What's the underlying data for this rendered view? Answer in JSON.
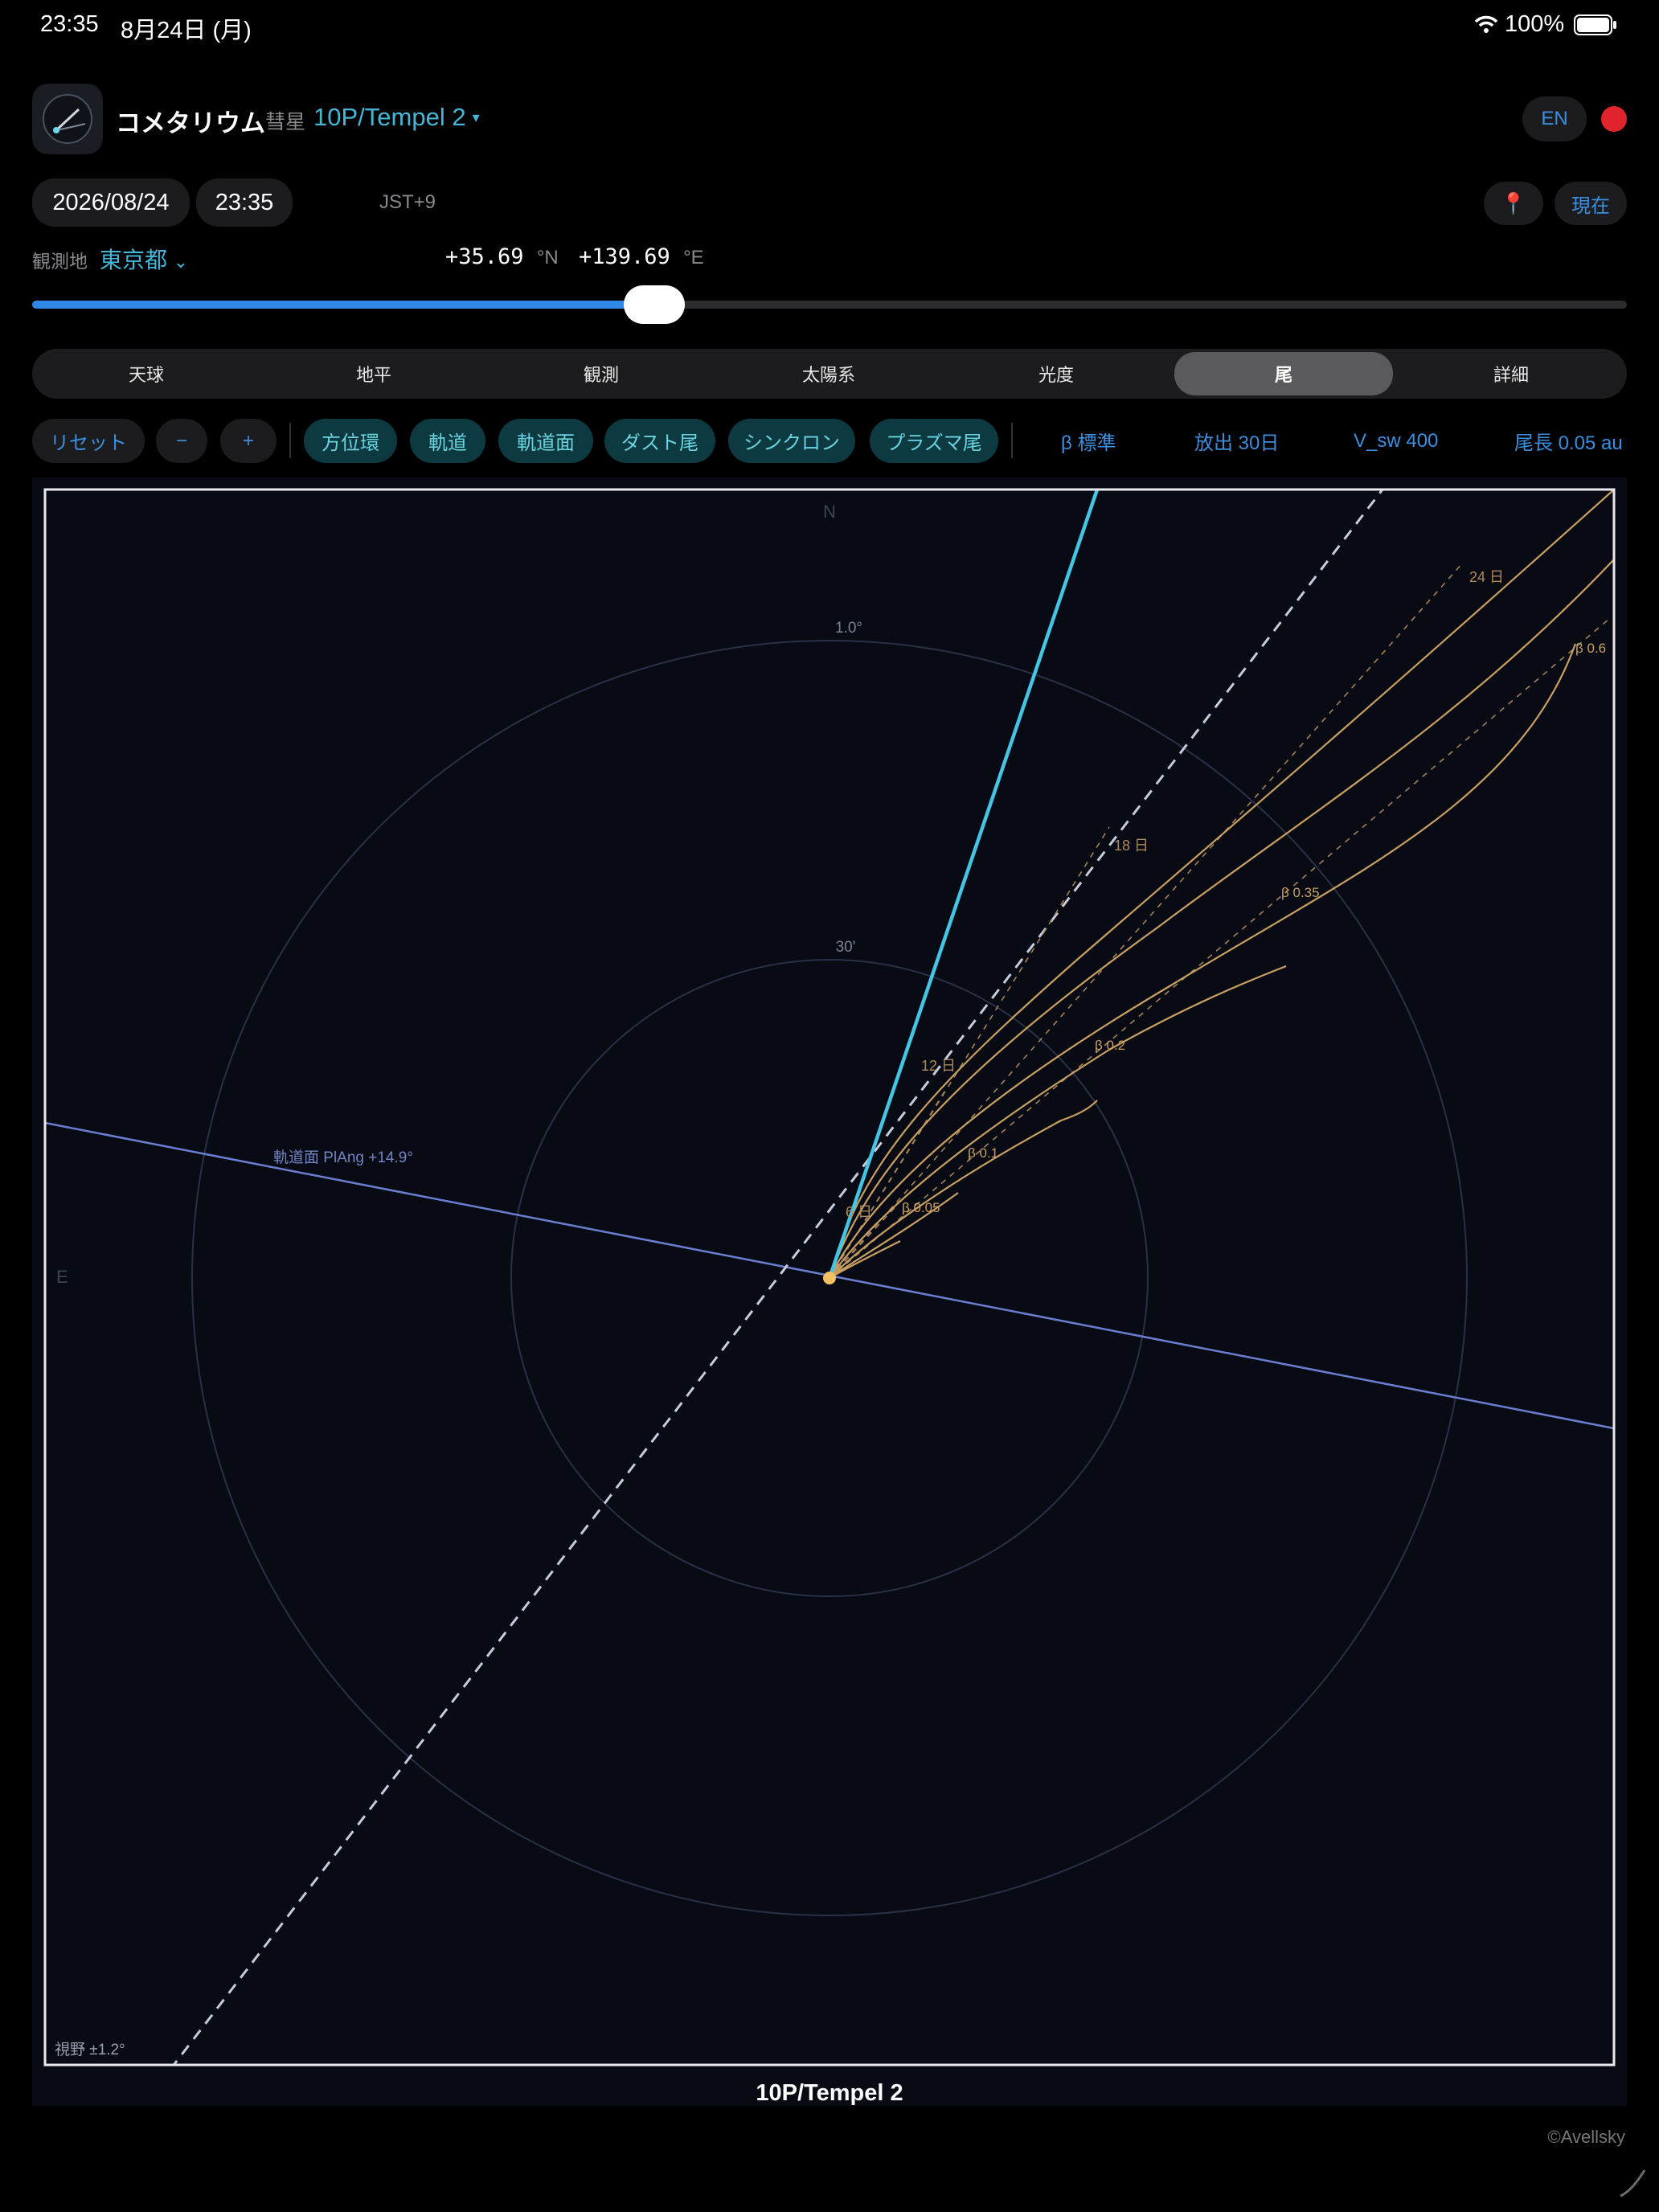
{
  "status_bar": {
    "time": "23:35",
    "date": "8月24日 (月)",
    "battery": "100%"
  },
  "header": {
    "app_name": "コメタリウム",
    "subtitle": "彗星",
    "comet_name": "10P/Tempel 2",
    "caret": "▾",
    "lang_button": "EN"
  },
  "datetime": {
    "date": "2026/08/24",
    "time": "23:35",
    "timezone": "JST+9",
    "pin_icon": "📍",
    "now_button": "現在"
  },
  "location": {
    "label": "観測地",
    "value": "東京都",
    "chevron": "⌄",
    "lat_value": "+35.69",
    "lat_unit": "°N",
    "lon_value": "+139.69",
    "lon_unit": "°E"
  },
  "time_slider": {
    "position": 0.39
  },
  "tabs": [
    "天球",
    "地平",
    "観測",
    "太陽系",
    "光度",
    "尾",
    "詳細"
  ],
  "active_tab": "尾",
  "toolbar": {
    "reset": "リセット",
    "minus": "−",
    "plus": "+",
    "toggles": [
      "方位環",
      "軌道",
      "軌道面",
      "ダスト尾",
      "シンクロン",
      "プラズマ尾"
    ],
    "beta": "β 標準",
    "emission": "放出 30日",
    "vsw": "V_sw 400",
    "tail_length": "尾長 0.05 au"
  },
  "plot": {
    "compass_n": "N",
    "compass_e": "E",
    "ring_outer_label": "1.0°",
    "ring_inner_label": "30'",
    "orbit_plane_label": "軌道面 PlAng +14.9°",
    "fov_label": "視野 ±1.2°",
    "title": "10P/Tempel 2",
    "synchrone_labels": [
      "24 日",
      "18 日",
      "12 日",
      "6 日"
    ],
    "syndyne_labels": [
      "β 0.6",
      "β 0.35",
      "β 0.2",
      "β 0.1",
      "β 0.05"
    ],
    "colors": {
      "background": "#080a14",
      "plasma_tail": "#45c4e4",
      "dust": "#c9a062",
      "orbit_plane": "#6a7fd1",
      "orbit": "#c7ccdd",
      "rings": "#2a3045"
    }
  },
  "copyright": "©Avellsky"
}
